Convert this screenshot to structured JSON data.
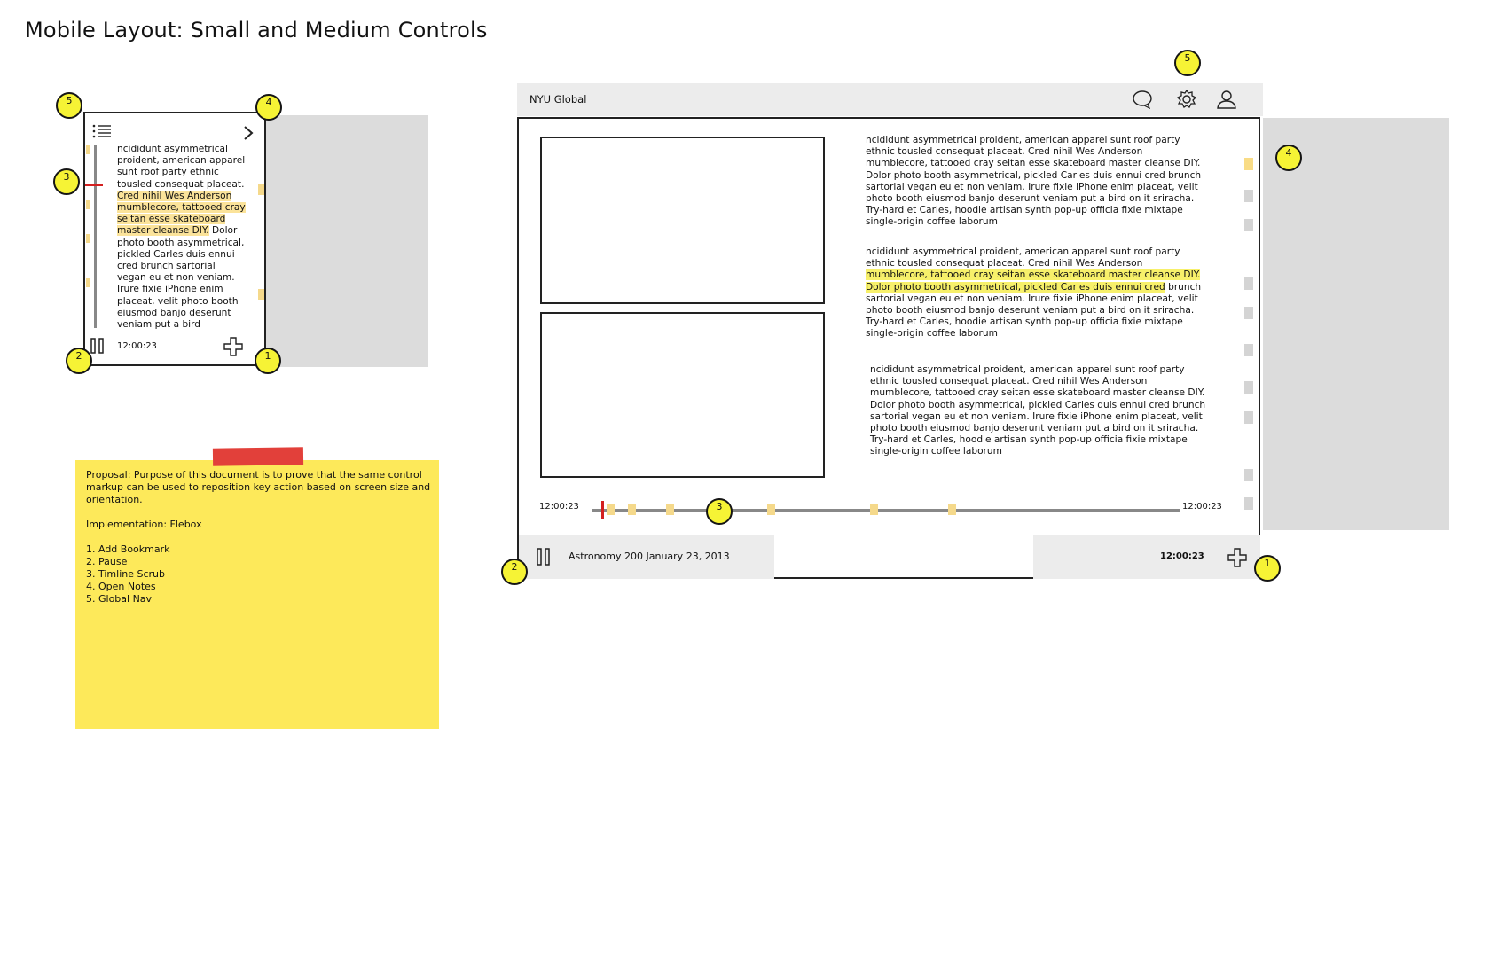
{
  "page": {
    "title": "Mobile Layout: Small and Medium Controls"
  },
  "small_mockup": {
    "body_before": "ncididunt asymmetrical proident, american apparel sunt roof party ethnic tousled consequat placeat.",
    "body_highlight": " Cred nihil Wes Anderson mumblecore, tattooed cray seitan esse skateboard master cleanse DIY.",
    "body_after": " Dolor photo booth asymmetrical, pickled Carles duis ennui cred brunch sartorial vegan eu et non veniam. Irure fixie iPhone enim placeat, velit photo booth eiusmod banjo deserunt veniam put a bird",
    "time": "12:00:23",
    "markers": {
      "m5": "5",
      "m4": "4",
      "m3": "3",
      "m2": "2",
      "m1": "1"
    }
  },
  "medium_mockup": {
    "nav_title": "NYU Global",
    "paragraph1": "ncididunt asymmetrical proident, american apparel sunt roof party ethnic tousled consequat placeat. Cred nihil Wes Anderson mumblecore, tattooed cray seitan esse skateboard master cleanse DIY. Dolor photo booth asymmetrical, pickled Carles duis ennui cred brunch sartorial vegan eu et non veniam. Irure fixie iPhone enim placeat, velit photo booth eiusmod banjo deserunt veniam put a bird on it sriracha. Try-hard et Carles, hoodie artisan synth pop-up officia fixie mixtape single-origin coffee laborum",
    "paragraph2_before": "ncididunt asymmetrical proident, american apparel sunt roof party ethnic tousled consequat placeat. Cred nihil Wes Anderson",
    "paragraph2_highlight": "mumblecore, tattooed cray seitan esse skateboard master cleanse DIY. Dolor photo booth asymmetrical, pickled Carles duis ennui cred",
    "paragraph2_after": "brunch sartorial vegan eu et non veniam. Irure fixie iPhone enim placeat, velit photo booth eiusmod banjo deserunt veniam put a bird on it sriracha. Try-hard et Carles, hoodie artisan synth pop-up officia fixie mixtape single-origin coffee laborum",
    "paragraph3": "ncididunt asymmetrical proident, american apparel sunt roof party ethnic tousled consequat placeat. Cred nihil Wes Anderson mumblecore, tattooed cray seitan esse skateboard master cleanse DIY. Dolor photo booth asymmetrical, pickled Carles duis ennui cred brunch sartorial vegan eu et non veniam. Irure fixie iPhone enim placeat, velit photo booth eiusmod banjo deserunt veniam put a bird on it sriracha. Try-hard et Carles, hoodie artisan synth pop-up officia fixie mixtape single-origin coffee laborum",
    "timeline_start": "12:00:23",
    "timeline_end": "12:00:23",
    "lecture_title": "Astronomy 200 January 23, 2013",
    "time": "12:00:23",
    "markers": {
      "m5": "5",
      "m4": "4",
      "m3": "3",
      "m2": "2",
      "m1": "1"
    }
  },
  "sticky_note": {
    "proposal": "Proposal: Purpose of this document is to prove that the same control markup can be used to reposition key action based on screen size and orientation.",
    "implementation": "Implementation: Flebox",
    "items": [
      "1. Add Bookmark",
      "2. Pause",
      "3. Timline Scrub",
      "4. Open Notes",
      "5. Global Nav"
    ]
  },
  "colors": {
    "marker_yellow": "#f6f335",
    "sticky_yellow": "#fde95a",
    "tape_red": "#e2403a",
    "scrub_red": "#d32020",
    "bookmark_yellow": "#f9dc86",
    "panel_gray": "#dcdcdc"
  },
  "icons": [
    "list-icon",
    "chevron-right-icon",
    "pause-icon",
    "add-bookmark-plus-icon",
    "chat-bubble-icon",
    "gear-icon",
    "user-icon"
  ]
}
